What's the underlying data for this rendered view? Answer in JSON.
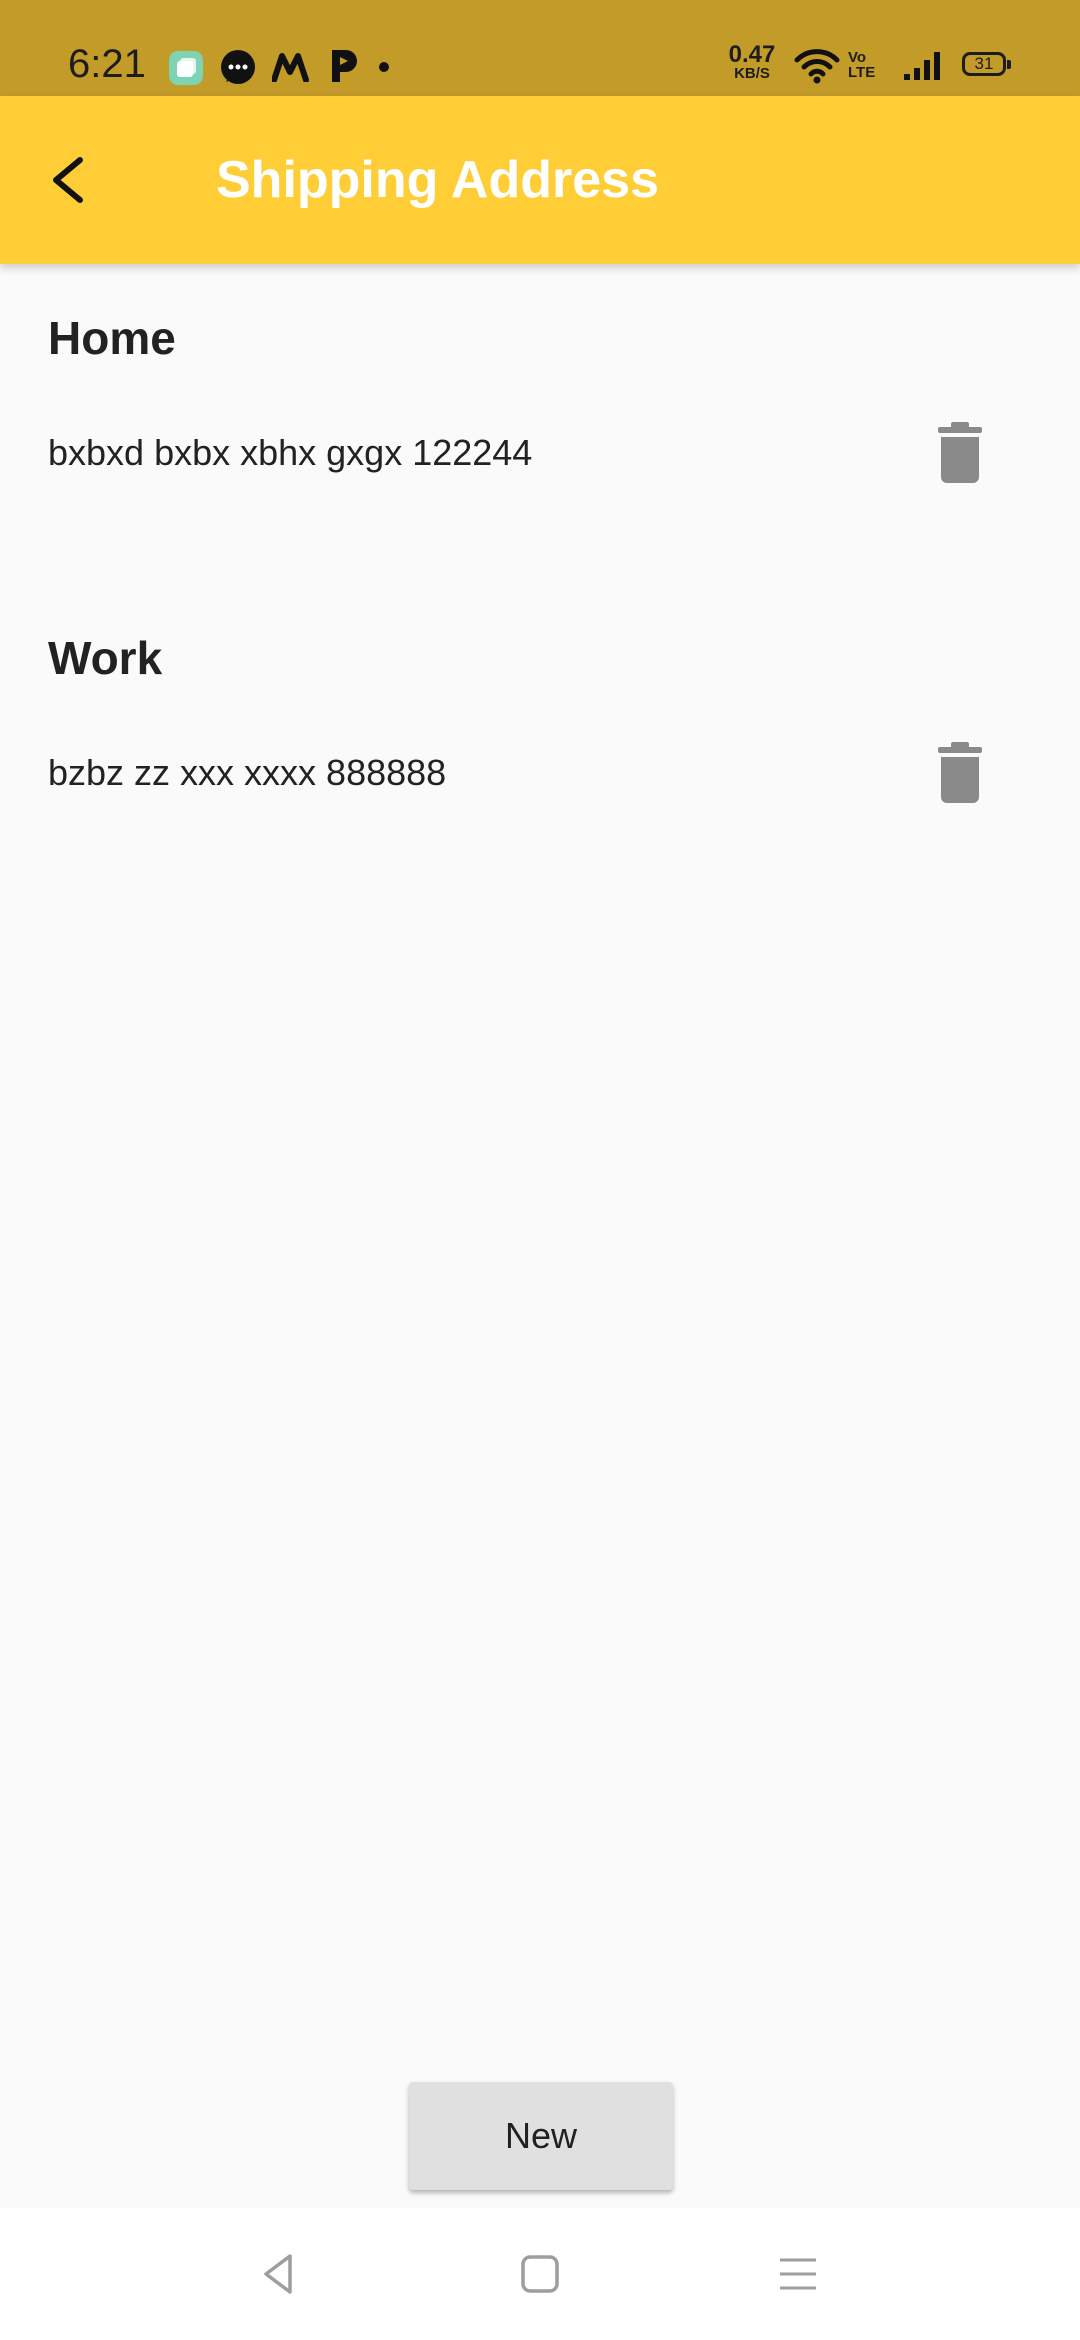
{
  "status_bar": {
    "time": "6:21",
    "net_speed_value": "0.47",
    "net_speed_unit": "KB/S",
    "volte_top": "Vo",
    "volte_bottom": "LTE",
    "battery": "31",
    "icons": [
      "app-notification-icon",
      "chat-icon",
      "m-app-icon",
      "p-app-icon",
      "more-notifications-dot-icon",
      "wifi-icon",
      "volte-icon",
      "signal-icon",
      "battery-icon"
    ]
  },
  "app_bar": {
    "title": "Shipping Address",
    "back_icon": "back-arrow-icon",
    "background": "#ffce36"
  },
  "addresses": [
    {
      "label": "Home",
      "address": "bxbxd bxbx xbhx gxgx 122244",
      "delete_icon": "trash-icon"
    },
    {
      "label": "Work",
      "address": "bzbz zz xxx xxxx 888888",
      "delete_icon": "trash-icon"
    }
  ],
  "actions": {
    "new_label": "New"
  },
  "nav_bar": {
    "icons": [
      "nav-back-icon",
      "nav-home-icon",
      "nav-recents-icon"
    ]
  },
  "colors": {
    "status_bar": "#c29b29",
    "accent": "#ffce36",
    "background": "#fafafa",
    "icon_grey": "#8a8a8a"
  }
}
